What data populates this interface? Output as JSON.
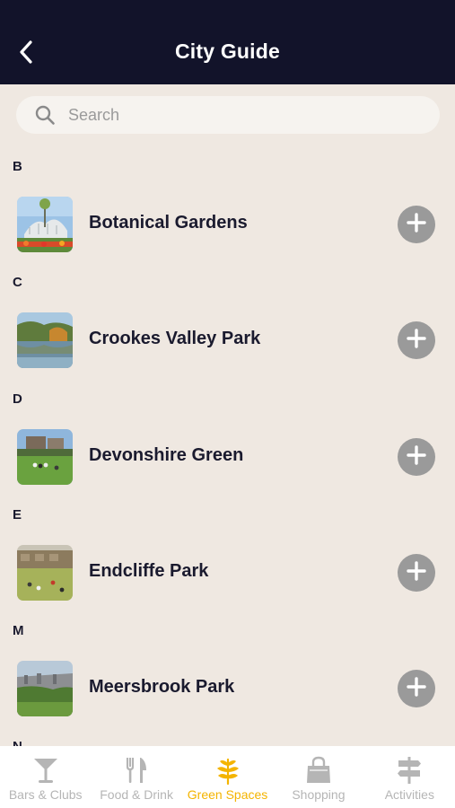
{
  "header": {
    "title": "City Guide",
    "back_icon": "chevron-left-icon"
  },
  "search": {
    "placeholder": "Search",
    "value": ""
  },
  "sections": [
    {
      "letter": "B",
      "items": [
        {
          "name": "Botanical Gardens",
          "thumb": "glasshouse-photo"
        }
      ]
    },
    {
      "letter": "C",
      "items": [
        {
          "name": "Crookes Valley Park",
          "thumb": "lake-photo"
        }
      ]
    },
    {
      "letter": "D",
      "items": [
        {
          "name": "Devonshire Green",
          "thumb": "green-photo"
        }
      ]
    },
    {
      "letter": "E",
      "items": [
        {
          "name": "Endcliffe Park",
          "thumb": "park-photo"
        }
      ]
    },
    {
      "letter": "M",
      "items": [
        {
          "name": "Meersbrook Park",
          "thumb": "view-photo"
        }
      ]
    },
    {
      "letter": "N",
      "items": []
    }
  ],
  "tabs": [
    {
      "label": "Bars & Clubs",
      "icon": "cocktail-glass-icon",
      "active": false
    },
    {
      "label": "Food & Drink",
      "icon": "fork-knife-icon",
      "active": false
    },
    {
      "label": "Green Spaces",
      "icon": "leaf-icon",
      "active": true
    },
    {
      "label": "Shopping",
      "icon": "shopping-bag-icon",
      "active": false
    },
    {
      "label": "Activities",
      "icon": "signpost-icon",
      "active": false
    }
  ],
  "colors": {
    "header_bg": "#12132a",
    "page_bg": "#efe8e1",
    "accent": "#f4b400",
    "inactive": "#b5b5b5",
    "add_button": "#9a9a9a"
  }
}
